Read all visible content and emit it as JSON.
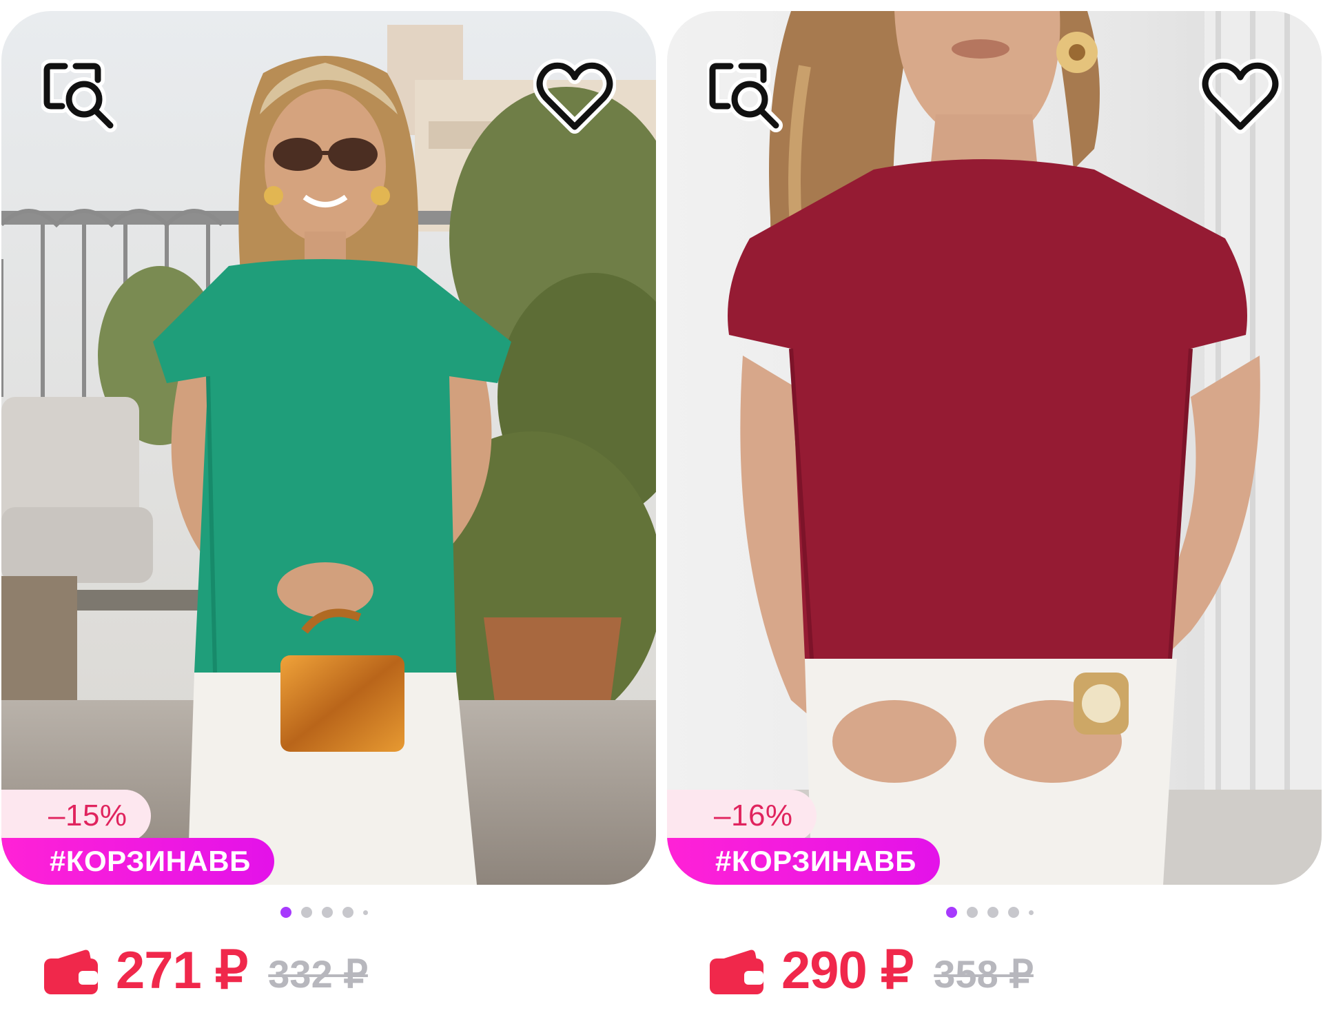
{
  "products": [
    {
      "discount_label": "–15%",
      "promo_tag": "#КОРЗИНАВБ",
      "price": "271 ₽",
      "old_price": "332 ₽",
      "color_name": "green",
      "shirt_color": "#1f9e7a",
      "icons": [
        "similar-search-icon",
        "heart-icon",
        "wallet-icon"
      ],
      "gallery_dots": 5,
      "active_dot": 0
    },
    {
      "discount_label": "–16%",
      "promo_tag": "#КОРЗИНАВБ",
      "price": "290 ₽",
      "old_price": "358 ₽",
      "color_name": "burgundy",
      "shirt_color": "#951b33",
      "icons": [
        "similar-search-icon",
        "heart-icon",
        "wallet-icon"
      ],
      "gallery_dots": 5,
      "active_dot": 0
    }
  ],
  "colors": {
    "price": "#f0284b",
    "old_price": "#b7b7bd",
    "discount_bg": "#fde7ef",
    "discount_text": "#e0245e",
    "tag_bg": "#ff22d6",
    "dot_active": "#a73afd",
    "dot_inactive": "#c7c7cc"
  }
}
